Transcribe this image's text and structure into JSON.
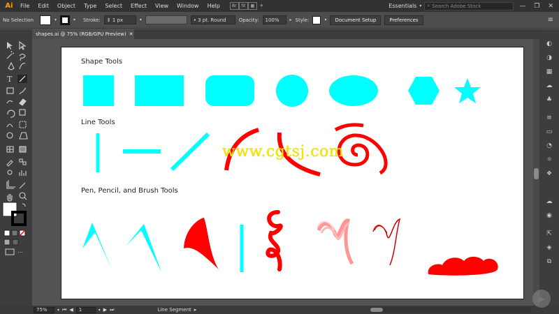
{
  "app": {
    "logo": "Ai"
  },
  "menu": [
    "File",
    "Edit",
    "Object",
    "Type",
    "Select",
    "Effect",
    "View",
    "Window",
    "Help"
  ],
  "menu_right": {
    "app_buttons": [
      "Br",
      "St"
    ],
    "workspace": "Essentials",
    "search_placeholder": "Search Adobe Stock",
    "window_controls": [
      "—",
      "❐",
      "✕"
    ]
  },
  "control_bar": {
    "selection": "No Selection",
    "stroke_label": "Stroke:",
    "stroke_value": "1 px",
    "brush_value": "3 pt. Round",
    "opacity_label": "Opacity:",
    "opacity_value": "100%",
    "style_label": "Style:",
    "document_setup": "Document Setup",
    "preferences": "Preferences"
  },
  "document_tab": {
    "title": "shapes.ai @ 75% (RGB/GPU Preview)",
    "close": "✕"
  },
  "artboard": {
    "sections": [
      "Shape Tools",
      "Line Tools",
      "Pen,  Pencil, and Brush Tools"
    ]
  },
  "colors": {
    "cyan": "#00ffff",
    "red": "#ff0000",
    "panel": "#3d3d3d",
    "menubar": "#323232"
  },
  "watermark": "www.cgtsj.com",
  "status_bar": {
    "zoom": "75%",
    "artboard_number": "1",
    "current_tool": "Line Segment"
  },
  "tools": [
    "selection-icon",
    "direct-selection-icon",
    "magic-wand-icon",
    "lasso-icon",
    "pen-icon",
    "curvature-icon",
    "type-icon",
    "line-segment-icon",
    "rectangle-icon",
    "paintbrush-icon",
    "shaper-icon",
    "eraser-icon",
    "rotate-icon",
    "scale-icon",
    "width-icon",
    "free-transform-icon",
    "shape-builder-icon",
    "perspective-icon",
    "mesh-icon",
    "gradient-icon",
    "eyedropper-icon",
    "blend-icon",
    "symbol-sprayer-icon",
    "column-graph-icon",
    "artboard-icon",
    "slice-icon",
    "hand-icon",
    "zoom-icon"
  ]
}
